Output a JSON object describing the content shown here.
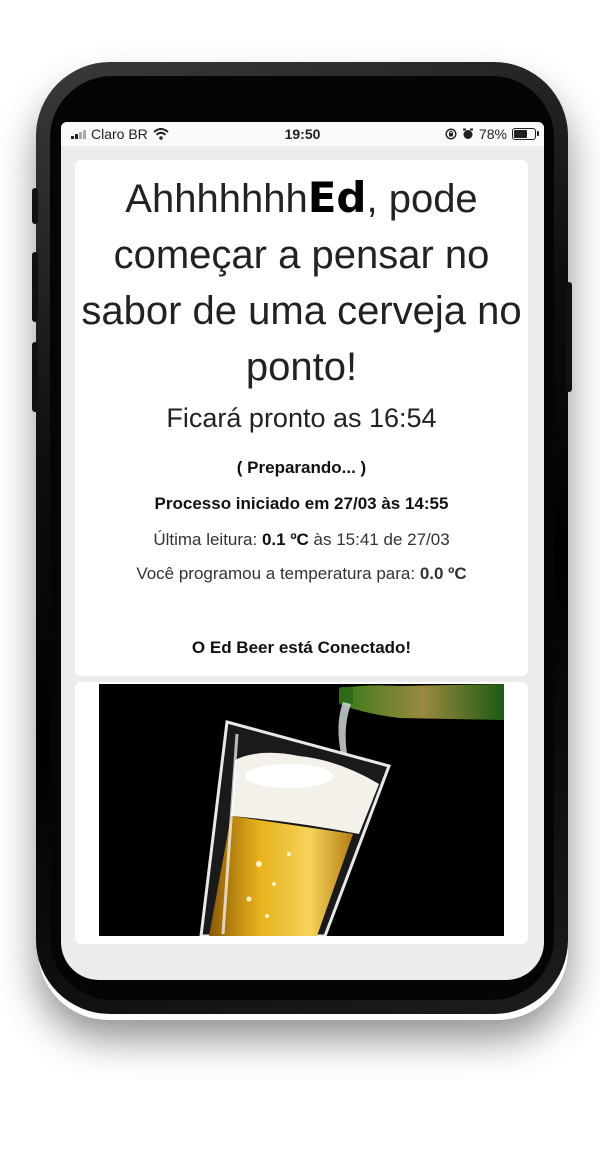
{
  "status_bar": {
    "carrier": "Claro BR",
    "time": "19:50",
    "battery": "78%",
    "battery_level": 0.78,
    "icons": [
      "signal-icon",
      "wifi-icon",
      "rotation-lock-icon",
      "alarm-icon",
      "battery-icon"
    ]
  },
  "headline": {
    "prefix": "Ahhhhhhh",
    "name": "Ed",
    "rest": ", pode começar a pensar no sabor de uma cerveja no ponto!"
  },
  "ready_text": "Ficará pronto as 16:54",
  "status_text": "( Preparando... )",
  "process_text": "Processo iniciado em 27/03 às 14:55",
  "last_reading": {
    "label": "Última leitura:",
    "value": "0.1 ºC",
    "suffix": "às 15:41 de 27/03"
  },
  "programmed": {
    "label": "Você programou a temperatura para:",
    "value": "0.0 ºC"
  },
  "connection_text": "O Ed Beer está Conectado!",
  "colors": {
    "screen_bg": "#ececee",
    "card_bg": "#ffffff",
    "text": "#111111",
    "beer": "#e8b21c"
  }
}
